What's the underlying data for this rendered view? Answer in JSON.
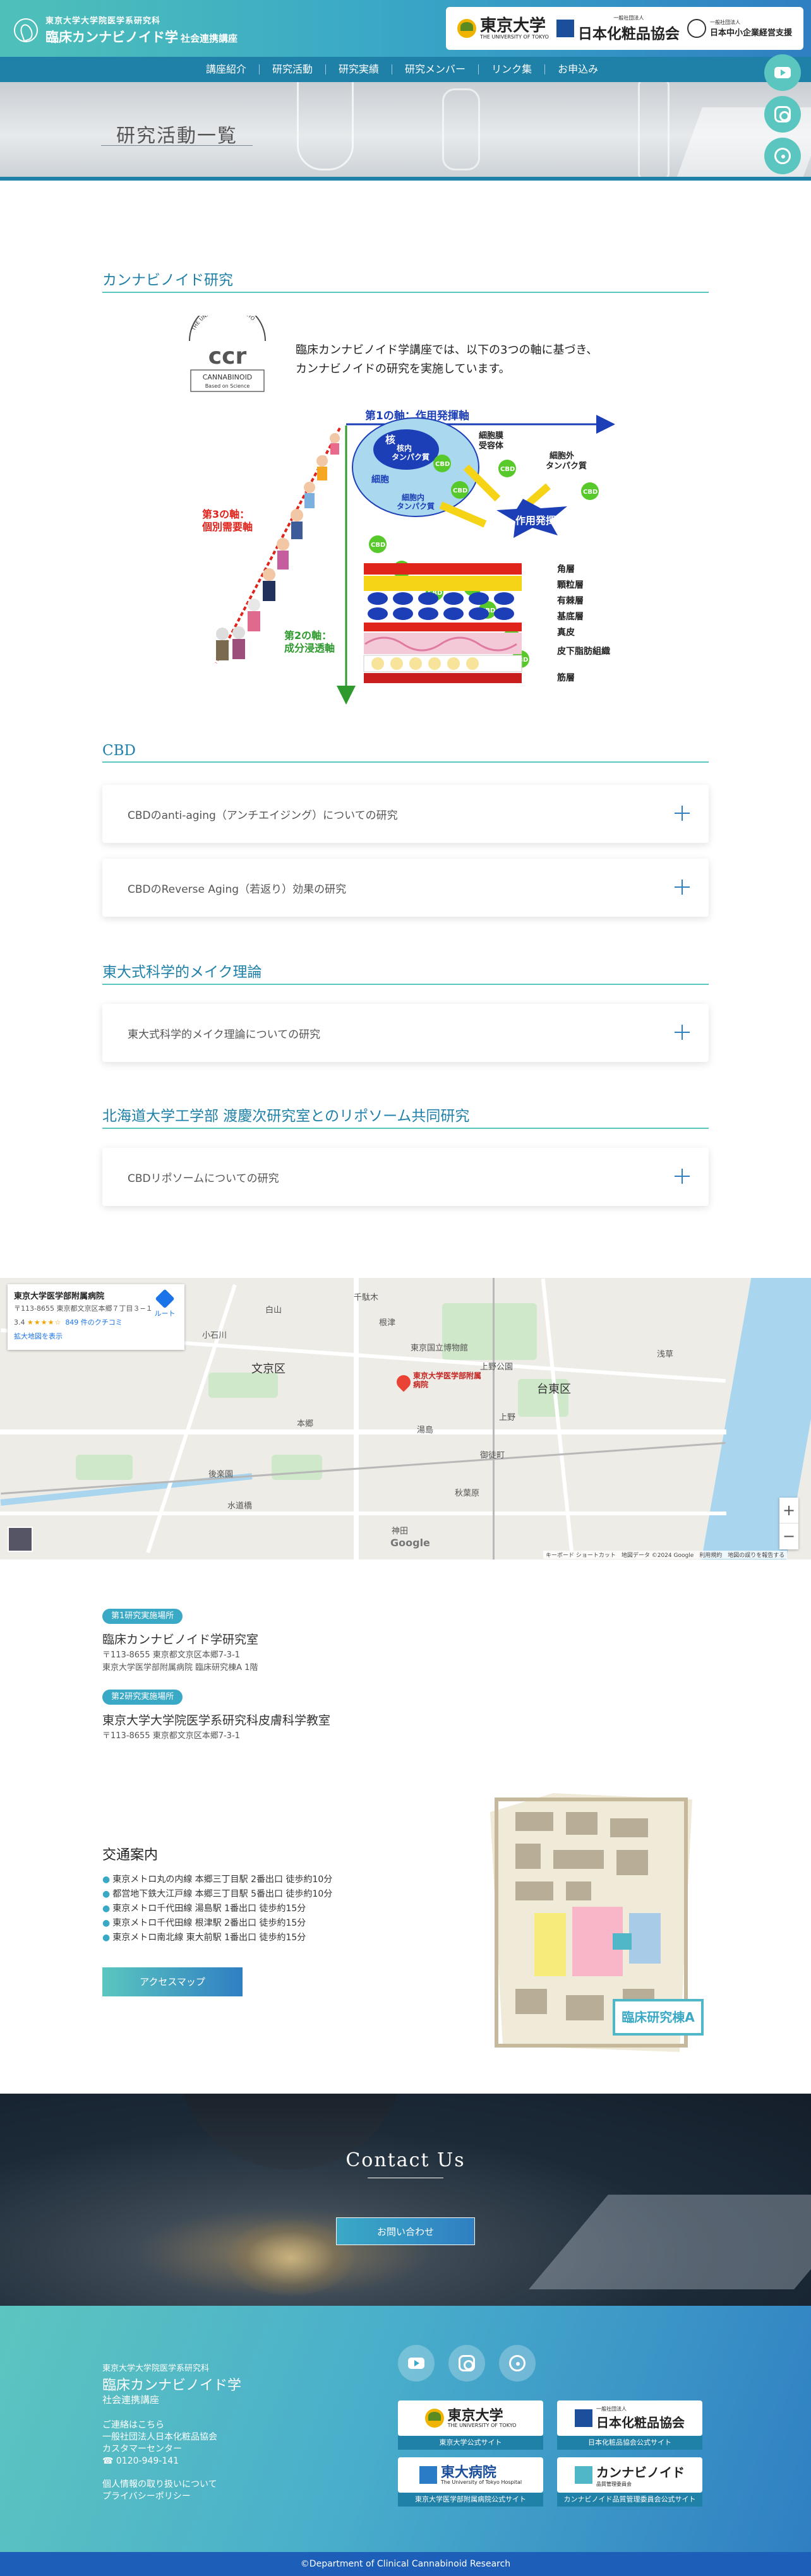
{
  "header": {
    "org_sub": "東京大学大学院医学系研究科",
    "org_main": "臨床カンナビノイド学",
    "org_suffix": "社会連携講座",
    "partners": [
      {
        "name": "東京大学",
        "en": "THE UNIVERSITY OF TOKYO"
      },
      {
        "name": "日本化粧品協会",
        "prefix": "一般社団法人"
      },
      {
        "name": "日本中小企業経営支援",
        "prefix": "一般社団法人"
      }
    ]
  },
  "nav": [
    "講座紹介",
    "研究活動",
    "研究実績",
    "研究メンバー",
    "リンク集",
    "お申込み"
  ],
  "side_icons": [
    "youtube-icon",
    "instagram-icon",
    "podcast-icon"
  ],
  "hero": {
    "title": "研究活動一覧"
  },
  "cannabinoid": {
    "section_title": "カンナビノイド研究",
    "badge_top": "THE UNIVERSITY OF TOKYO",
    "badge_logo": "ccr",
    "badge_text": "CANNABINOID",
    "badge_sub": "Based on Science",
    "intro_line1": "臨床カンナビノイド学講座では、以下の3つの軸に基づき、",
    "intro_line2": "カンナビノイドの研究を実施しています。"
  },
  "diagram": {
    "axis1": "第1の軸：作用発揮軸",
    "axis2_line1": "第2の軸：",
    "axis2_line2": "成分浸透軸",
    "axis3_line1": "第3の軸：",
    "axis3_line2": "個別需要軸",
    "cell": "細胞",
    "nucleus": "核",
    "nuclear_protein_1": "核内",
    "nuclear_protein_2": "タンパク質",
    "intracellular_1": "細胞内",
    "intracellular_2": "タンパク質",
    "membrane_1": "細胞膜",
    "membrane_2": "受容体",
    "extracellular_1": "細胞外",
    "extracellular_2": "タンパク質",
    "effect": "作用発揮",
    "cbd": "CBD",
    "layers": [
      "角層",
      "顆粒層",
      "有棘層",
      "基底層",
      "真皮",
      "皮下脂肪組織",
      "筋層"
    ],
    "colors": {
      "blue": "#1c3fb8",
      "green": "#2e9a2e",
      "red": "#e0231b",
      "yellow": "#f5d417"
    }
  },
  "cbd": {
    "section_title": "CBD",
    "items": [
      "CBDのanti-aging（アンチエイジング）についての研究",
      "CBDのReverse Aging（若返り）効果の研究"
    ]
  },
  "makeup": {
    "section_title": "東大式科学的メイク理論",
    "items": [
      "東大式科学的メイク理論についての研究"
    ]
  },
  "hokkaido": {
    "section_title": "北海道大学工学部 渡慶次研究室とのリポソーム共同研究",
    "items": [
      "CBDリポソームについての研究"
    ]
  },
  "map": {
    "place": "東京大学医学部附属病院",
    "address": "〒113-8655 東京都文京区本郷７丁目３−１",
    "rating": "3.4",
    "stars": "★★★★☆",
    "reviews": "849 件のクチコミ",
    "enlarge": "拡大地図を表示",
    "route": "ルート",
    "pin_label": "東京大学医学部附属病院",
    "labels": [
      "文京区",
      "台東区",
      "東京国立博物館",
      "上野公園",
      "湯島",
      "本郷",
      "後楽園",
      "根津",
      "千駄木",
      "上野",
      "浅草",
      "神田",
      "秋葉原",
      "御徒町",
      "水道橋",
      "小石川",
      "白山"
    ],
    "google": "Google",
    "footer": "キーボード ショートカット　地図データ ©2024 Google　利用規約　地図の誤りを報告する",
    "zoom_in": "+",
    "zoom_out": "−"
  },
  "locations": [
    {
      "tag": "第1研究実施場所",
      "name": "臨床カンナビノイド学研究室",
      "addr1": "〒113-8655 東京都文京区本郷7-3-1",
      "addr2": "東京大学医学部附属病院 臨床研究棟A 1階"
    },
    {
      "tag": "第2研究実施場所",
      "name": "東京大学大学院医学系研究科皮膚科学教室",
      "addr1": "〒113-8655 東京都文京区本郷7-3-1"
    }
  ],
  "access": {
    "title": "交通案内",
    "items": [
      "東京メトロ丸の内線 本郷三丁目駅 2番出口 徒歩約10分",
      "都営地下鉄大江戸線 本郷三丁目駅 5番出口 徒歩約10分",
      "東京メトロ千代田線 湯島駅 1番出口 徒歩約15分",
      "東京メトロ千代田線 根津駅 2番出口 徒歩約15分",
      "東京メトロ南北線 東大前駅 1番出口 徒歩約15分"
    ],
    "button": "アクセスマップ",
    "campus_label": "臨床研究棟A"
  },
  "contact": {
    "title": "Contact Us",
    "button": "お問い合わせ"
  },
  "footer": {
    "sub": "東京大学大学院医学系研究科",
    "main": "臨床カンナビノイド学",
    "main2": "社会連携講座",
    "links": [
      "ご連絡はこちら",
      "一般社団法人日本化粧品協会",
      "カスタマーセンター",
      "0120-949-141",
      "個人情報の取り扱いについて",
      "プライバシーポリシー"
    ],
    "banners": [
      {
        "name": "東京大学",
        "en": "THE UNIVERSITY OF TOKYO",
        "caption": "東京大学公式サイト"
      },
      {
        "name": "日本化粧品協会",
        "prefix": "一般社団法人",
        "caption": "日本化粧品協会公式サイト"
      },
      {
        "name": "東大病院",
        "en": "The University of Tokyo Hospital",
        "caption": "東京大学医学部附属病院公式サイト"
      },
      {
        "name": "カンナビノイド",
        "sub": "品質管理委員会",
        "caption": "カンナビノイド品質管理委員会公式サイト"
      }
    ],
    "copyright": "©Department of Clinical Cannabinoid Research"
  }
}
